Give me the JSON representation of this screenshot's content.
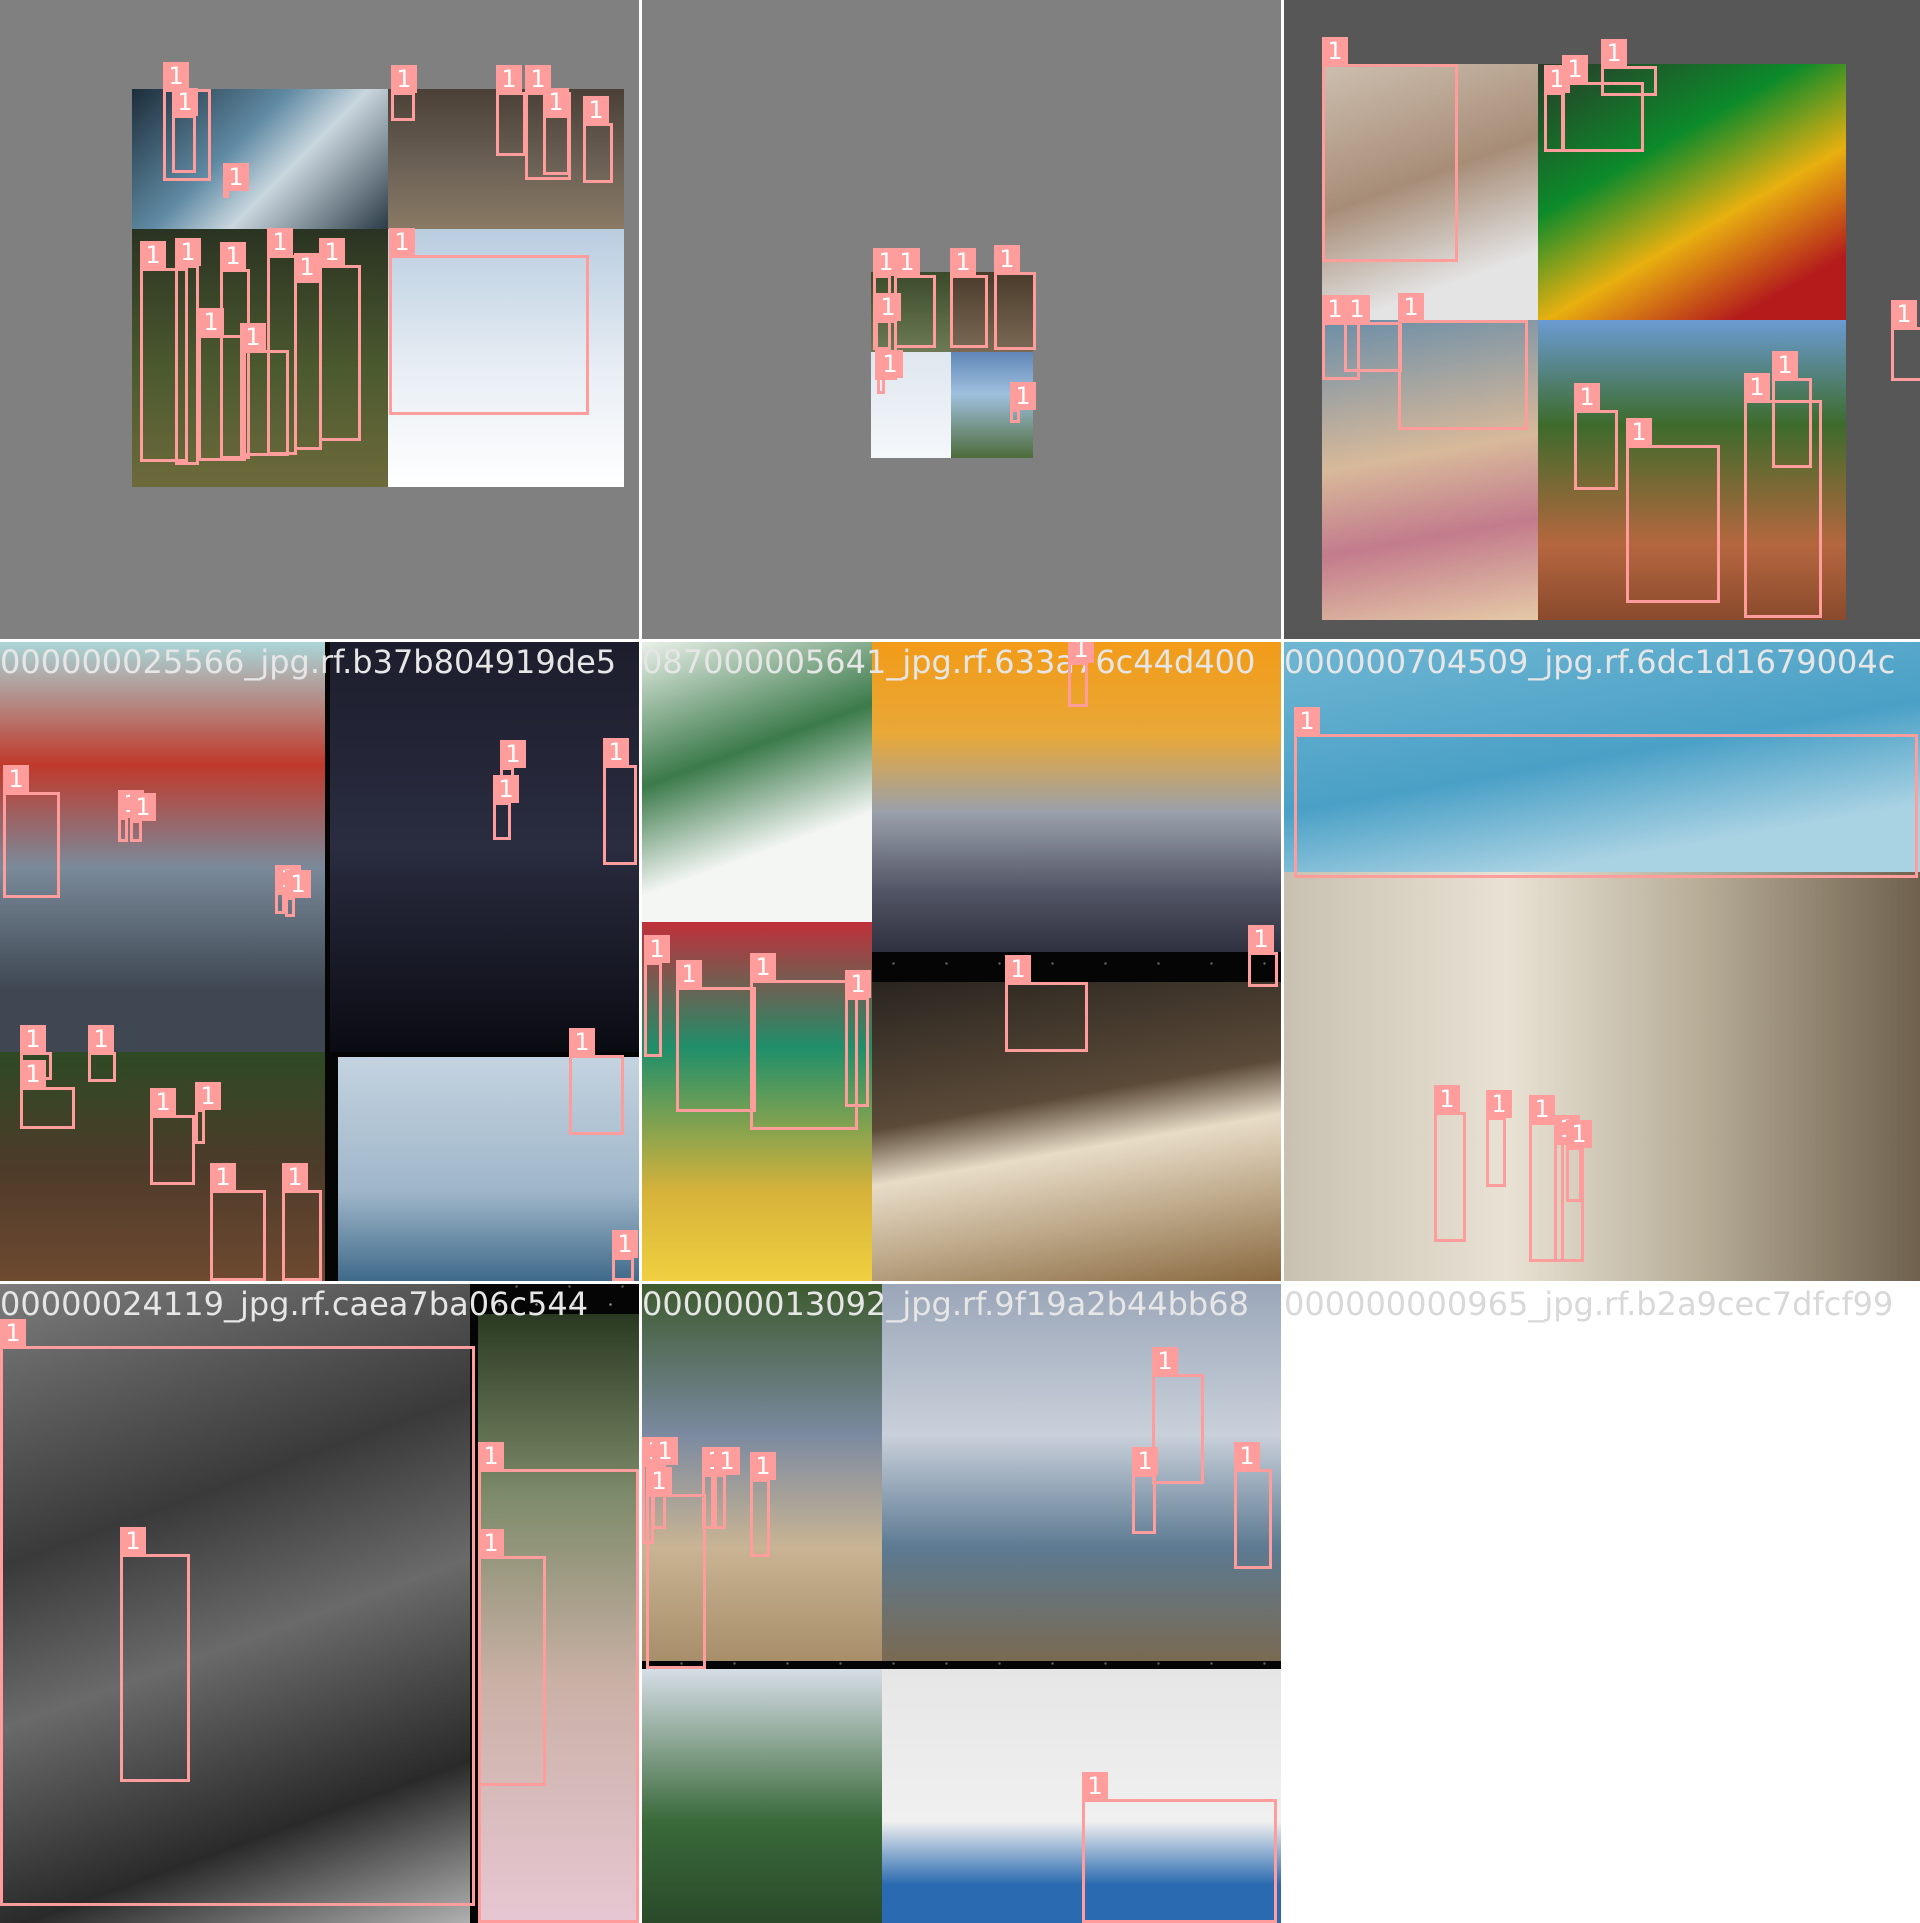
{
  "tiles": [
    {
      "id": "t1",
      "name": ""
    },
    {
      "id": "t2",
      "name": ""
    },
    {
      "id": "t3",
      "name": ""
    },
    {
      "id": "t4",
      "name": "000000025566_jpg.rf.b37b804919de5"
    },
    {
      "id": "t5",
      "name": "087000005641_jpg.rf.633a76c44d400"
    },
    {
      "id": "t6",
      "name": "000000704509_jpg.rf.6dc1d1679004c"
    },
    {
      "id": "t7",
      "name": "00000024119_jpg.rf.caea7ba06c544"
    },
    {
      "id": "t8",
      "name": "000000013092_jpg.rf.9f19a2b44bb68"
    },
    {
      "id": "t9",
      "name": "000000000965_jpg.rf.b2a9cec7dfcf99"
    }
  ],
  "box_label": "1",
  "colors": {
    "box": "#ff9c9c",
    "label_text": "#ffffff",
    "pad": "#808080"
  }
}
